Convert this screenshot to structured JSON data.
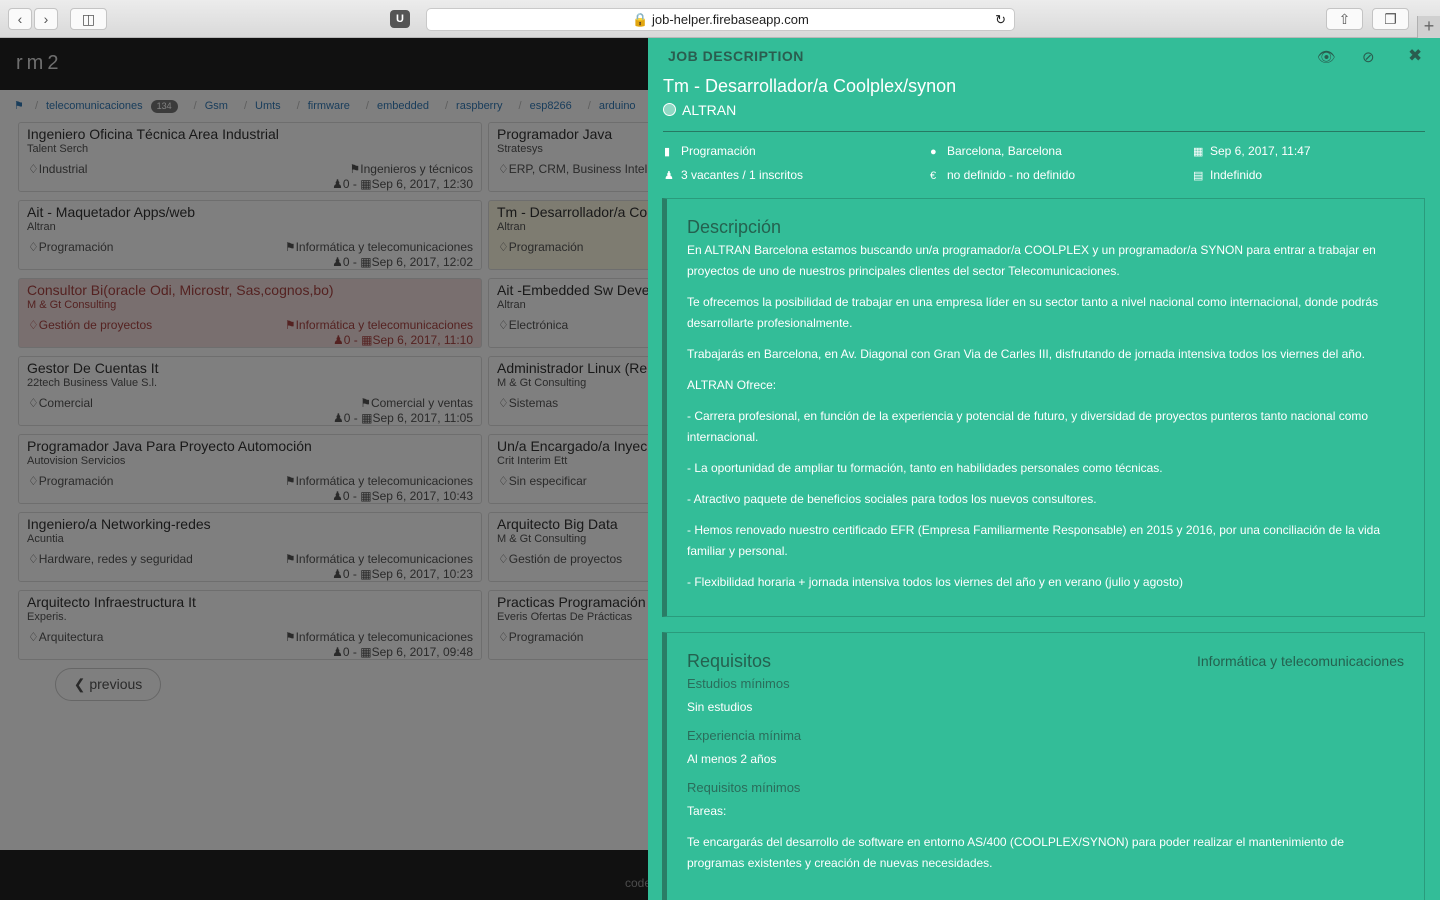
{
  "browser": {
    "url": "job-helper.firebaseapp.com",
    "ext_badge": "U"
  },
  "app": {
    "brand": "rm2",
    "footer_text": "code",
    "prev_label": "previous"
  },
  "tags": [
    {
      "label": "telecomunicaciones",
      "count": "134"
    },
    {
      "label": "Gsm"
    },
    {
      "label": "Umts"
    },
    {
      "label": "firmware"
    },
    {
      "label": "embedded"
    },
    {
      "label": "raspberry"
    },
    {
      "label": "esp8266"
    },
    {
      "label": "arduino"
    },
    {
      "label": "in"
    }
  ],
  "jobs_left": [
    {
      "title": "Ingeniero Oficina Técnica Area Industrial",
      "company": "Talent Serch",
      "category": "Industrial",
      "sector": "Ingenieros y técnicos",
      "count": "0",
      "date": "Sep 6, 2017, 12:30"
    },
    {
      "title": "Ait - Maquetador Apps/web",
      "company": "Altran",
      "category": "Programación",
      "sector": "Informática y telecomunicaciones",
      "count": "0",
      "date": "Sep 6, 2017, 12:02"
    },
    {
      "title": "Consultor Bi(oracle Odi, Microstr, Sas,cognos,bo)",
      "company": "M & Gt Consulting",
      "category": "Gestión de proyectos",
      "sector": "Informática y telecomunicaciones",
      "count": "0",
      "date": "Sep 6, 2017, 11:10"
    },
    {
      "title": "Gestor De Cuentas It",
      "company": "22tech Business Value S.l.",
      "category": "Comercial",
      "sector": "Comercial y ventas",
      "count": "0",
      "date": "Sep 6, 2017, 11:05"
    },
    {
      "title": "Programador Java Para Proyecto Automoción",
      "company": "Autovision Servicios",
      "category": "Programación",
      "sector": "Informática y telecomunicaciones",
      "count": "0",
      "date": "Sep 6, 2017, 10:43"
    },
    {
      "title": "Ingeniero/a Networking-redes",
      "company": "Acuntia",
      "category": "Hardware, redes y seguridad",
      "sector": "Informática y telecomunicaciones",
      "count": "0",
      "date": "Sep 6, 2017, 10:23"
    },
    {
      "title": "Arquitecto Infraestructura It",
      "company": "Experis.",
      "category": "Arquitectura",
      "sector": "Informática y telecomunicaciones",
      "count": "0",
      "date": "Sep 6, 2017, 09:48"
    }
  ],
  "jobs_right": [
    {
      "title": "Programador Java",
      "company": "Stratesys",
      "category": "ERP, CRM, Business Intelli"
    },
    {
      "title": "Tm - Desarrollador/a Co",
      "company": "Altran",
      "category": "Programación"
    },
    {
      "title": "Ait -Embedded Sw Devel",
      "company": "Altran",
      "category": "Electrónica"
    },
    {
      "title": "Administrador Linux (Re",
      "company": "M & Gt Consulting",
      "category": "Sistemas"
    },
    {
      "title": "Un/a Encargado/a Inyec",
      "company": "Crit Interim Ett",
      "category": "Sin especificar"
    },
    {
      "title": "Arquitecto Big Data",
      "company": "M & Gt Consulting",
      "category": "Gestión de proyectos"
    },
    {
      "title": "Practicas Programación",
      "company": "Everis Ofertas De Prácticas",
      "category": "Programación"
    }
  ],
  "panel": {
    "heading": "JOB DESCRIPTION",
    "title": "Tm - Desarrollador/a Coolplex/synon",
    "company": "ALTRAN",
    "category": "Programación",
    "location": "Barcelona, Barcelona",
    "date": "Sep 6, 2017, 11:47",
    "vacancies": "3 vacantes / 1 inscritos",
    "salary": "no definido - no definido",
    "contract": "Indefinido",
    "desc_title": "Descripción",
    "desc": [
      "En ALTRAN Barcelona estamos buscando un/a programador/a COOLPLEX y un programador/a SYNON para entrar a trabajar en proyectos de uno de nuestros principales clientes del sector Telecomunicaciones.",
      "Te ofrecemos la posibilidad de trabajar en una empresa líder en su sector tanto a nivel nacional como internacional, donde podrás desarrollarte profesionalmente.",
      "Trabajarás en Barcelona, en Av. Diagonal con Gran Via de Carles III, disfrutando de jornada intensiva todos los viernes del año.",
      "ALTRAN Ofrece:",
      "- Carrera profesional, en función de la experiencia y potencial de futuro, y diversidad de proyectos punteros tanto nacional como internacional.",
      "- La oportunidad de ampliar tu formación, tanto en habilidades personales como técnicas.",
      "- Atractivo paquete de beneficios sociales para todos los nuevos consultores.",
      "- Hemos renovado nuestro certificado EFR (Empresa Familiarmente Responsable) en 2015 y 2016, por una conciliación de la vida familiar y personal.",
      "- Flexibilidad horaria + jornada intensiva todos los viernes del año y en verano (julio y agosto)"
    ],
    "req_title": "Requisitos",
    "req_sector": "Informática y telecomunicaciones",
    "studies_label": "Estudios mínimos",
    "studies": "Sin estudios",
    "exp_label": "Experiencia mínima",
    "exp": "Al menos 2 años",
    "minreq_label": "Requisitos mínimos",
    "tasks_label": "Tareas:",
    "tasks": "Te encargarás del desarrollo de software en entorno AS/400 (COOLPLEX/SYNON) para poder realizar el mantenimiento de programas existentes y creación de nuevas necesidades."
  }
}
